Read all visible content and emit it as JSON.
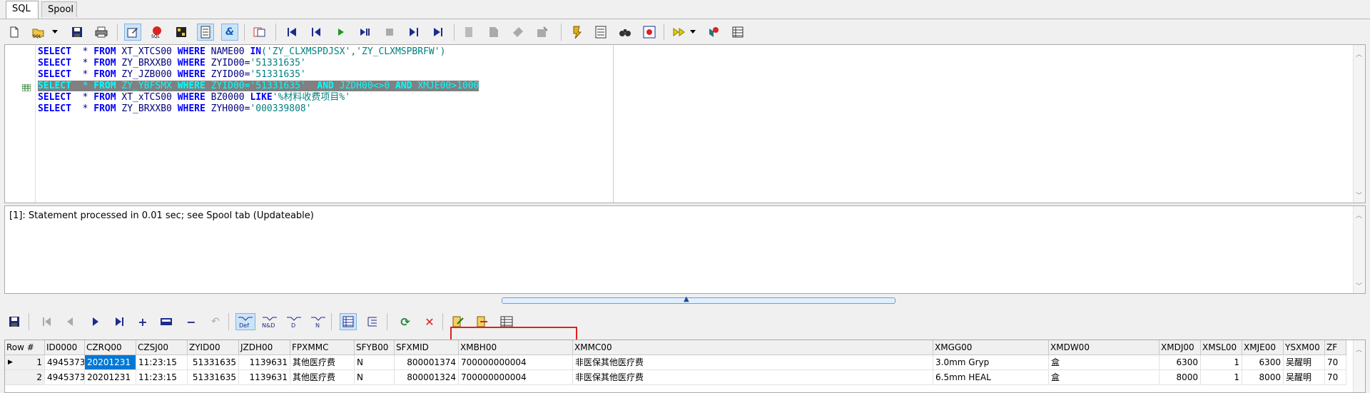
{
  "tabs": [
    {
      "label": "SQL"
    },
    {
      "label": "Spool"
    }
  ],
  "toolbar_top_icons": [
    "new-file-icon",
    "open-sql-icon",
    "dropdown-arrow-icon",
    "save-icon",
    "print-icon",
    "edit-sql-icon",
    "stop-query-icon",
    "grid-icon",
    "query-builder-icon",
    "format-sql-icon",
    "copy-icon",
    "first-icon",
    "previous-icon",
    "run-icon",
    "run-all-icon",
    "stop-icon",
    "next-icon",
    "last-icon",
    "cut-icon",
    "paste-icon",
    "copy-clip-icon",
    "clear-icon",
    "explain-icon",
    "list-icon",
    "find-icon",
    "options-icon",
    "macro-icon",
    "dropdown-arrow-icon",
    "bookmark-icon",
    "table-icon"
  ],
  "sql_lines": [
    {
      "tokens": [
        {
          "t": "SELECT",
          "c": "kw"
        },
        {
          "t": "  * ",
          "c": "id"
        },
        {
          "t": "FROM",
          "c": "kw"
        },
        {
          "t": " XT_XTCS00 ",
          "c": "id"
        },
        {
          "t": "WHERE",
          "c": "kw"
        },
        {
          "t": " NAME00 ",
          "c": "id"
        },
        {
          "t": "IN",
          "c": "kw"
        },
        {
          "t": "('ZY_CLXMSPDJSX','ZY_CLXMSPBRFW')",
          "c": "str"
        }
      ]
    },
    {
      "tokens": [
        {
          "t": "SELECT",
          "c": "kw"
        },
        {
          "t": "  * ",
          "c": "id"
        },
        {
          "t": "FROM",
          "c": "kw"
        },
        {
          "t": " ZY_BRXXB0 ",
          "c": "id"
        },
        {
          "t": "WHERE",
          "c": "kw"
        },
        {
          "t": " ZYID00=",
          "c": "id"
        },
        {
          "t": "'51331635'",
          "c": "str"
        }
      ]
    },
    {
      "tokens": [
        {
          "t": "SELECT",
          "c": "kw"
        },
        {
          "t": "  * ",
          "c": "id"
        },
        {
          "t": "FROM",
          "c": "kw"
        },
        {
          "t": " ZY_JZB000 ",
          "c": "id"
        },
        {
          "t": "WHERE",
          "c": "kw"
        },
        {
          "t": " ZYID00=",
          "c": "id"
        },
        {
          "t": "'51331635'",
          "c": "str"
        }
      ]
    },
    {
      "highlight": true,
      "tokens": [
        {
          "t": "SELECT",
          "c": "kw"
        },
        {
          "t": "  * ",
          "c": "id"
        },
        {
          "t": "FROM",
          "c": "kw"
        },
        {
          "t": " ZY_YBFSMX ",
          "c": "id"
        },
        {
          "t": "WHERE",
          "c": "kw"
        },
        {
          "t": " ZYID00=",
          "c": "id"
        },
        {
          "t": "'51331635'",
          "c": "str"
        },
        {
          "t": "  ",
          "c": "id"
        },
        {
          "t": "AND",
          "c": "kw"
        },
        {
          "t": " JZDH00<>0 ",
          "c": "id"
        },
        {
          "t": "AND",
          "c": "kw"
        },
        {
          "t": " XMJE00>1000",
          "c": "id"
        }
      ]
    },
    {
      "tokens": [
        {
          "t": "SELECT",
          "c": "kw"
        },
        {
          "t": "  * ",
          "c": "id"
        },
        {
          "t": "FROM",
          "c": "kw"
        },
        {
          "t": " XT_xTCS00 ",
          "c": "id"
        },
        {
          "t": "WHERE",
          "c": "kw"
        },
        {
          "t": " BZ0000 ",
          "c": "id"
        },
        {
          "t": "LIKE",
          "c": "kw"
        },
        {
          "t": "'%材料收费项目%'",
          "c": "str"
        }
      ]
    },
    {
      "tokens": [
        {
          "t": "SELECT",
          "c": "kw"
        },
        {
          "t": "  * ",
          "c": "id"
        },
        {
          "t": "FROM",
          "c": "kw"
        },
        {
          "t": " ZY_BRXXB0 ",
          "c": "id"
        },
        {
          "t": "WHERE",
          "c": "kw"
        },
        {
          "t": " ZYH000=",
          "c": "id"
        },
        {
          "t": "'000339808'",
          "c": "str"
        }
      ]
    }
  ],
  "status_message": "[1]: Statement processed in 0.01 sec; see Spool tab (Updateable)",
  "toolbar_bottom_icons": [
    "save-icon",
    "first-record-icon",
    "prior-record-icon",
    "next-record-icon",
    "last-record-icon",
    "insert-record-icon",
    "edit-record-icon",
    "delete-record-icon",
    "cancel-edit-icon",
    "def-icon",
    "nd-icon",
    "d-icon",
    "n-icon",
    "grid-view-icon",
    "form-view-icon",
    "refresh-icon",
    "cancel-icon",
    "export-icon",
    "import-icon",
    "table-settings-icon"
  ],
  "grid": {
    "columns": [
      "Row #",
      "ID0000",
      "CZRQ00",
      "CZSJ00",
      "ZYID00",
      "JZDH00",
      "FPXMMC",
      "SFYB00",
      "SFXMID",
      "XMBH00",
      "XMMC00",
      "XMGG00",
      "XMDW00",
      "XMDJ00",
      "XMSL00",
      "XMJE00",
      "YSXM00",
      "ZF"
    ],
    "rows": [
      [
        "1",
        "4945373",
        "20201231",
        "11:23:15",
        "51331635",
        "1139631",
        "其他医疗费",
        "N",
        "800001374",
        "700000000004",
        "非医保其他医疗费",
        "3.0mm Gryp",
        "盒",
        "6300",
        "1",
        "6300",
        "吴醒明",
        "70"
      ],
      [
        "2",
        "4945373",
        "20201231",
        "11:23:15",
        "51331635",
        "1139631",
        "其他医疗费",
        "N",
        "800001324",
        "700000000004",
        "非医保其他医疗费",
        "6.5mm HEAL",
        "盒",
        "8000",
        "1",
        "8000",
        "吴醒明",
        "70"
      ]
    ]
  },
  "colors": {
    "highlight_bg": "#808080",
    "highlight_fg": "#00ffff",
    "keyword": "#0000ff",
    "string": "#008080",
    "selection": "#0078d7",
    "annotation_box": "#e02020"
  }
}
